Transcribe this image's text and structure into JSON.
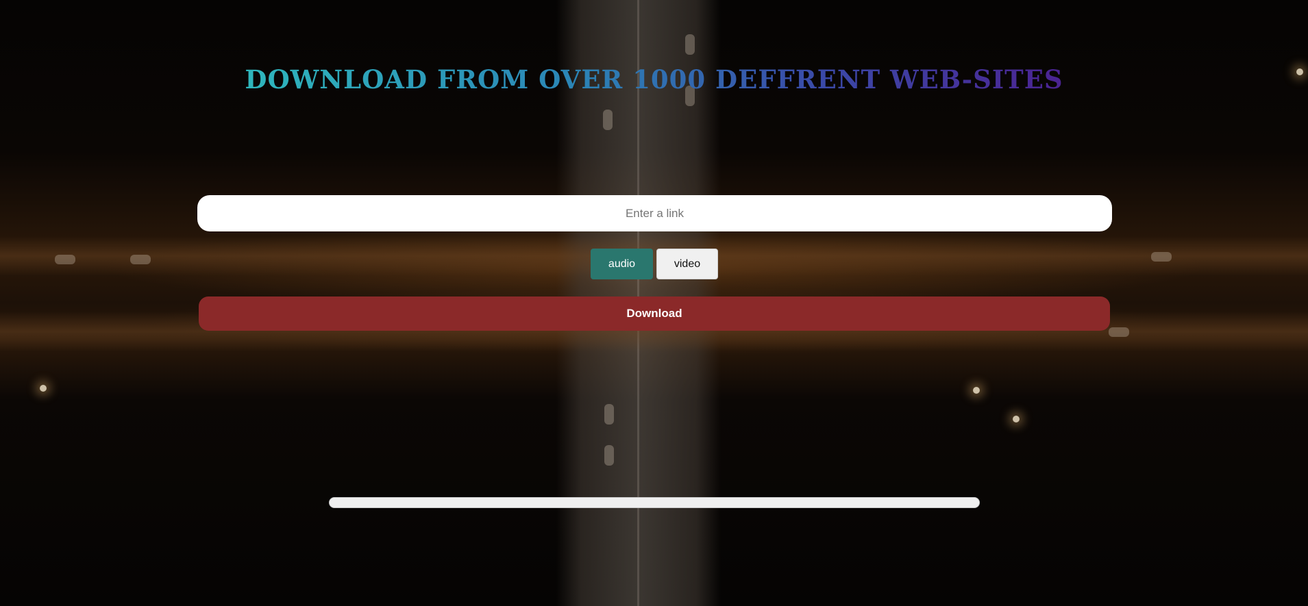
{
  "header": {
    "title": "DOWNLOAD FROM OVER 1000 DEFFRENT WEB-SITES"
  },
  "link_input": {
    "value": "",
    "placeholder": "Enter a link"
  },
  "format_toggle": {
    "options": [
      "audio",
      "video"
    ],
    "selected": "audio"
  },
  "download_button": {
    "label": "Download"
  },
  "progress": {
    "value_percent": 0
  },
  "colors": {
    "title_gradient_start": "#2fb6bc",
    "title_gradient_end": "#4b2392",
    "audio_active": "#2a776e",
    "download_button": "#8b2929"
  }
}
